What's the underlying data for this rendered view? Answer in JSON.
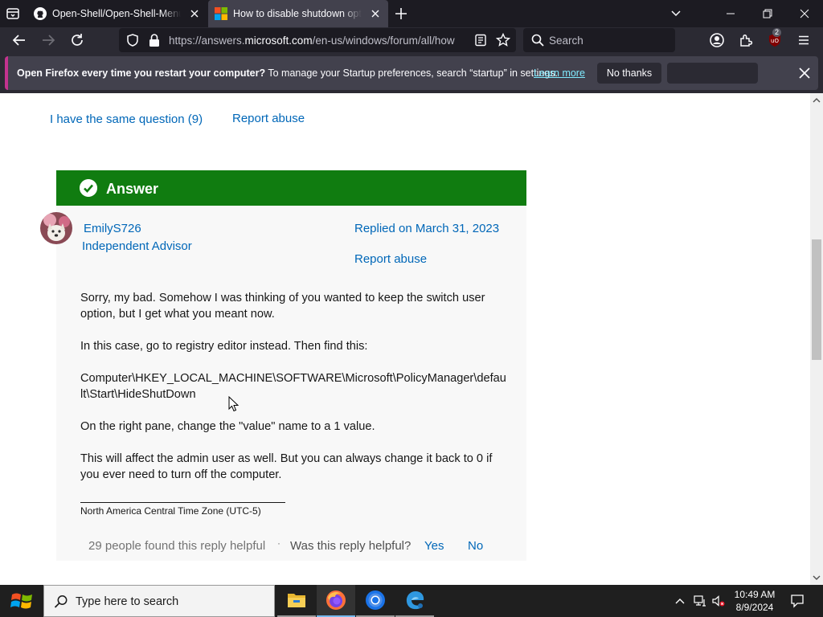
{
  "browser": {
    "tabs": [
      {
        "title": "Open-Shell/Open-Shell-Menu: Cl",
        "active": false
      },
      {
        "title": "How to disable shutdown option",
        "active": true
      }
    ],
    "url_prefix": "https://answers.",
    "url_domain": "microsoft.com",
    "url_path": "/en-us/windows/forum/all/how",
    "search_placeholder": "Search",
    "extension_badge": "2"
  },
  "notification": {
    "bold_text": "Open Firefox every time you restart your computer?",
    "text": " To manage your Startup preferences, search “startup” in settings.",
    "link": "Learn more",
    "no_thanks": "No thanks",
    "accent_color": "#c3338f"
  },
  "page": {
    "same_question": "I have the same question (9)",
    "report_abuse_top": "Report abuse",
    "answer_label": "Answer",
    "answer_color": "#107c10",
    "user_name": "EmilyS726",
    "user_role": "Independent Advisor",
    "replied": "Replied on March 31, 2023",
    "report_abuse": "Report abuse",
    "paragraphs": [
      "Sorry, my bad. Somehow I was thinking of you wanted to keep the switch user option, but I get what you meant now.",
      "In this case, go to registry editor instead. Then find this:",
      "Computer\\HKEY_LOCAL_MACHINE\\SOFTWARE\\Microsoft\\PolicyManager\\default\\Start\\HideShutDown",
      "On the right pane, change the \"value\" name to a 1 value.",
      "This will affect the admin user as well. But you can always change it back to 0 if you ever need to turn off the computer."
    ],
    "signature": "North America Central Time Zone (UTC-5)",
    "helpful_count": "29 people found this reply helpful",
    "separator": "·",
    "was_helpful": "Was this reply helpful?",
    "yes": "Yes",
    "no": "No",
    "link_color": "#0067b8"
  },
  "taskbar": {
    "search_placeholder": "Type here to search",
    "apps": [
      "file-explorer",
      "firefox",
      "chrome",
      "edge-beta"
    ],
    "time": "10:49 AM",
    "date": "8/9/2024"
  }
}
